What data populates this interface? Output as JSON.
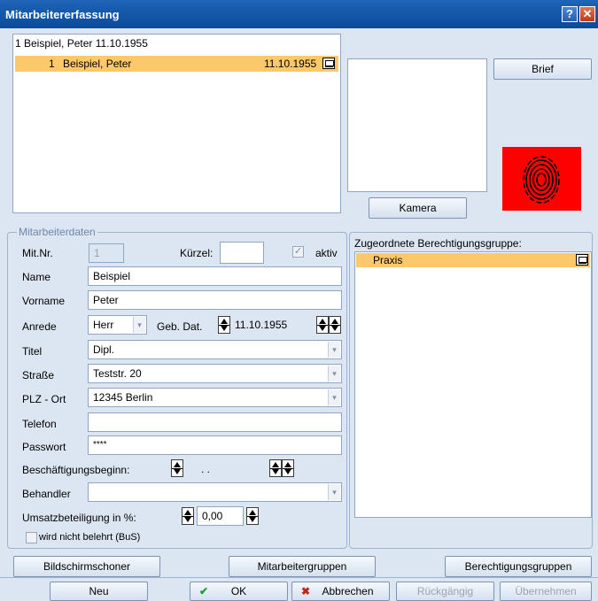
{
  "window": {
    "title": "Mitarbeitererfassung",
    "help_label": "?",
    "close_label": "✕"
  },
  "list": {
    "header": "1 Beispiel, Peter  11.10.1955",
    "rows": [
      {
        "num": "1",
        "name": "Beispiel, Peter",
        "date": "11.10.1955"
      }
    ]
  },
  "buttons": {
    "brief": "Brief",
    "kamera": "Kamera",
    "bildschirmschoner": "Bildschirmschoner",
    "mitarbeitergruppen": "Mitarbeitergruppen",
    "berechtigungsgruppen": "Berechtigungsgruppen",
    "neu": "Neu",
    "ok": "OK",
    "abbrechen": "Abbrechen",
    "rueckgaengig": "Rückgängig",
    "uebernehmen": "Übernehmen"
  },
  "form": {
    "group_title": "Mitarbeiterdaten",
    "mitnr_label": "Mit.Nr.",
    "mitnr_value": "1",
    "kuerzel_label": "Kürzel:",
    "kuerzel_value": "",
    "aktiv_label": "aktiv",
    "aktiv_checked": true,
    "name_label": "Name",
    "name_value": "Beispiel",
    "vorname_label": "Vorname",
    "vorname_value": "Peter",
    "anrede_label": "Anrede",
    "anrede_value": "Herr",
    "gebdat_label": "Geb. Dat.",
    "gebdat_value": "11.10.1955",
    "titel_label": "Titel",
    "titel_value": "Dipl.",
    "strasse_label": "Straße",
    "strasse_value": "Teststr. 20",
    "plz_label": "PLZ - Ort",
    "plz_value": "12345 Berlin",
    "telefon_label": "Telefon",
    "telefon_value": "",
    "passwort_label": "Passwort",
    "passwort_value": "****",
    "beschaeftigung_label": "Beschäftigungsbeginn:",
    "beschaeftigung_value": ". .",
    "behandler_label": "Behandler",
    "behandler_value": "",
    "umsatz_label": "Umsatzbeteiligung in %:",
    "umsatz_value": "0,00",
    "belehrt_label": "wird nicht belehrt (BuS)",
    "belehrt_checked": false
  },
  "groups": {
    "title": "Zugeordnete Berechtigungsgruppe:",
    "items": [
      "Praxis"
    ]
  },
  "colors": {
    "selection": "#fbc96a",
    "titlebar": "#0a4a9a",
    "fingerprint_bg": "#ff0000"
  },
  "icons": {
    "check": "✔",
    "cross": "✖"
  }
}
